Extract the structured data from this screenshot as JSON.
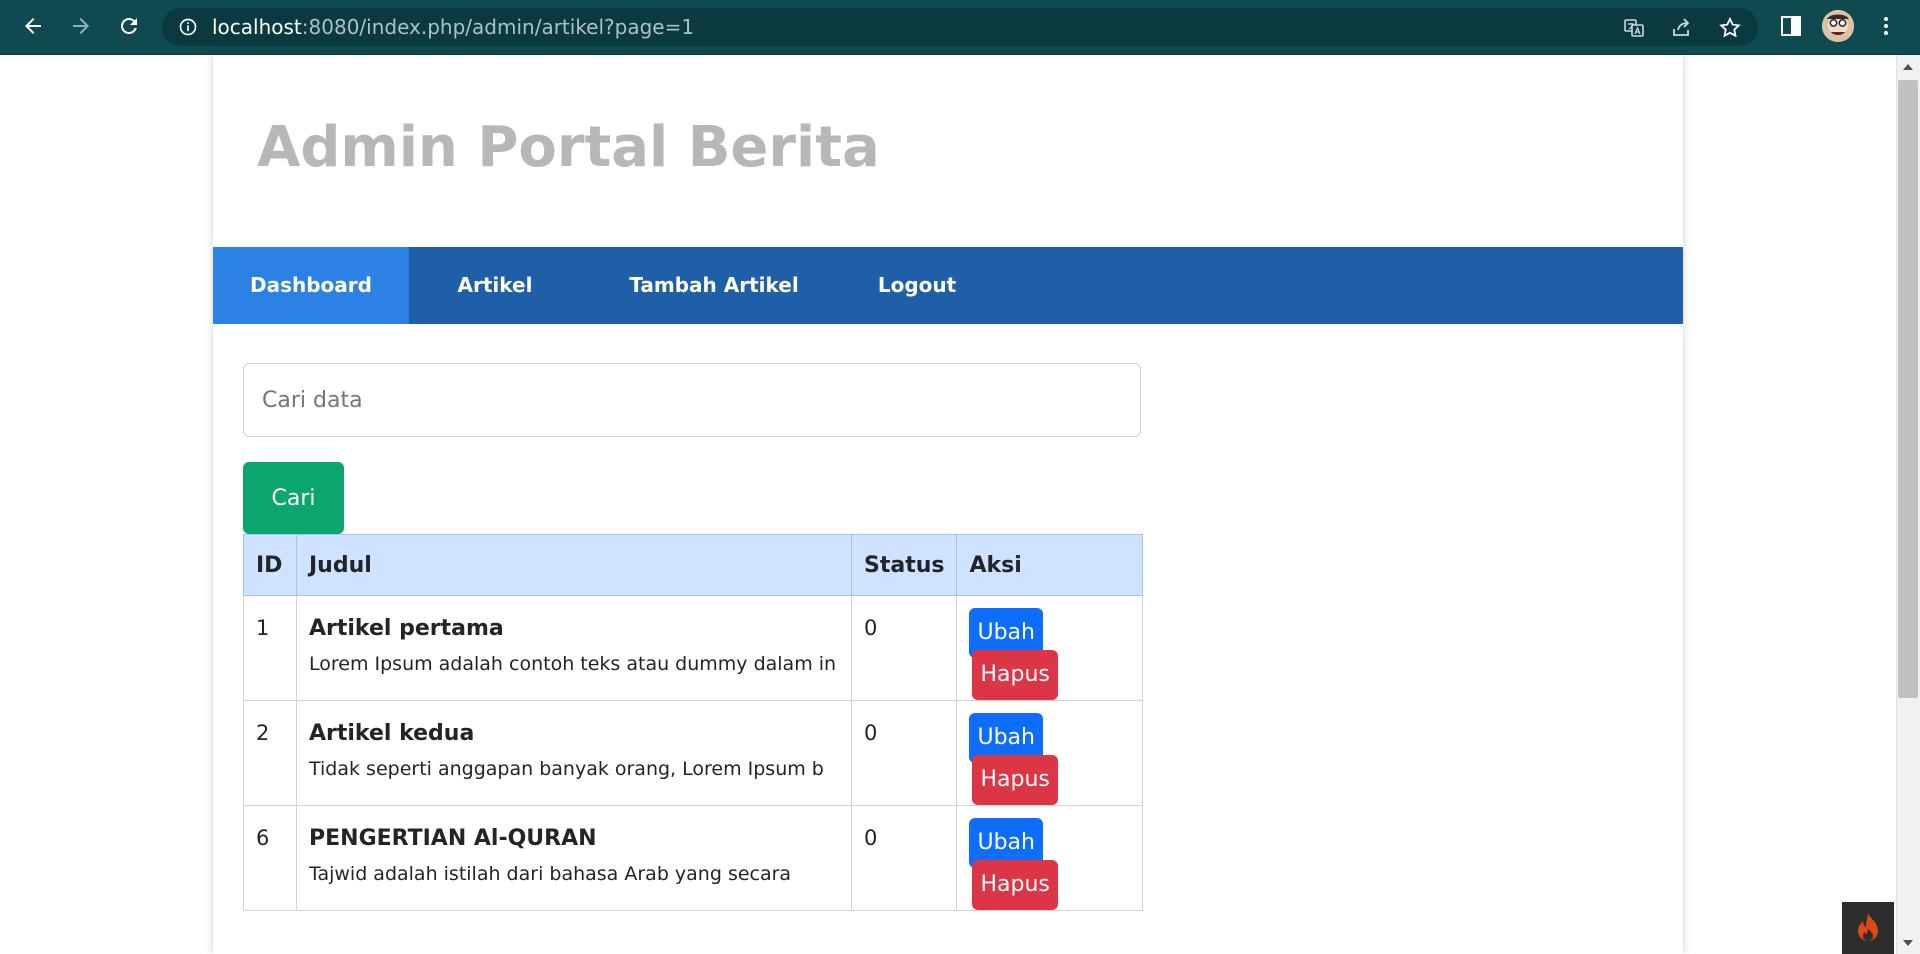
{
  "browser": {
    "url_host": "localhost",
    "url_rest": ":8080/index.php/admin/artikel?page=1"
  },
  "site": {
    "title": "Admin Portal Berita"
  },
  "menu": {
    "items": [
      {
        "label": "Dashboard",
        "active": true
      },
      {
        "label": "Artikel"
      },
      {
        "label": "Tambah Artikel"
      },
      {
        "label": "Logout"
      }
    ]
  },
  "search": {
    "placeholder": "Cari data",
    "button_label": "Cari"
  },
  "table": {
    "headers": [
      "ID",
      "Judul",
      "Status",
      "Aksi"
    ],
    "rows": [
      {
        "id": "1",
        "title": "Artikel pertama",
        "desc": "Lorem Ipsum adalah contoh teks atau dummy dalam in",
        "status": "0",
        "edit": "Ubah",
        "delete": "Hapus"
      },
      {
        "id": "2",
        "title": "Artikel kedua",
        "desc": "Tidak seperti anggapan banyak orang, Lorem Ipsum b",
        "status": "0",
        "edit": "Ubah",
        "delete": "Hapus"
      },
      {
        "id": "6",
        "title": "PENGERTIAN Al-QURAN",
        "desc": "Tajwid adalah istilah dari bahasa Arab yang secara",
        "status": "0",
        "edit": "Ubah",
        "delete": "Hapus"
      }
    ]
  },
  "colors": {
    "chrome": "#0e4a50",
    "menu_bg": "#1e5fa8",
    "menu_active": "#2b82e4",
    "search_button": "#0ba56e",
    "table_header": "#cfe2ff",
    "edit_button": "#0d6efd",
    "delete_button": "#dc3545"
  }
}
